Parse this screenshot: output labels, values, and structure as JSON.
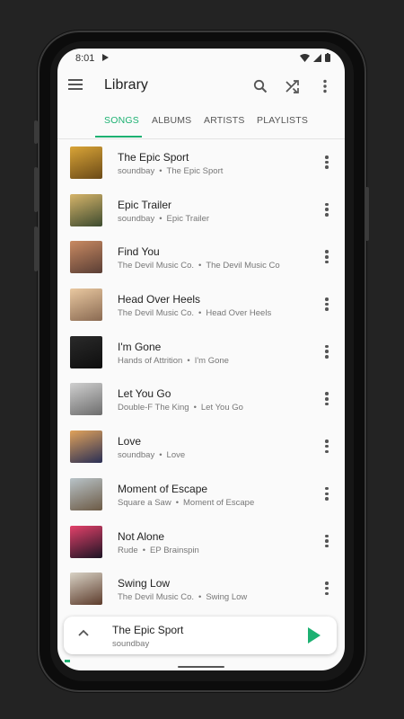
{
  "status_bar": {
    "time": "8:01"
  },
  "app_bar": {
    "title": "Library"
  },
  "tabs": [
    {
      "label": "SONGS",
      "active": true
    },
    {
      "label": "ALBUMS",
      "active": false
    },
    {
      "label": "ARTISTS",
      "active": false
    },
    {
      "label": "PLAYLISTS",
      "active": false
    }
  ],
  "songs": [
    {
      "title": "The Epic Sport",
      "artist": "soundbay",
      "album": "The Epic Sport",
      "cover_colors": [
        "#d9a437",
        "#6b4a17"
      ]
    },
    {
      "title": "Epic Trailer",
      "artist": "soundbay",
      "album": "Epic Trailer",
      "cover_colors": [
        "#d6b46a",
        "#3d4b2f"
      ]
    },
    {
      "title": "Find You",
      "artist": "The Devil Music Co.",
      "album": "The Devil Music Co",
      "cover_colors": [
        "#c98a62",
        "#5a3e35"
      ]
    },
    {
      "title": "Head Over Heels",
      "artist": "The Devil Music Co.",
      "album": "Head Over Heels",
      "cover_colors": [
        "#e9c8a0",
        "#8a6a52"
      ]
    },
    {
      "title": "I'm Gone",
      "artist": "Hands of Attrition",
      "album": "I'm Gone",
      "cover_colors": [
        "#2a2a2a",
        "#0e0e0e"
      ]
    },
    {
      "title": "Let You Go",
      "artist": "Double-F The King",
      "album": "Let You Go",
      "cover_colors": [
        "#cfcfcf",
        "#6d6d6d"
      ]
    },
    {
      "title": "Love",
      "artist": "soundbay",
      "album": "Love",
      "cover_colors": [
        "#e0a25b",
        "#2a2f55"
      ]
    },
    {
      "title": "Moment of Escape",
      "artist": "Square a Saw",
      "album": "Moment of Escape",
      "cover_colors": [
        "#b8c3c8",
        "#6c5a45"
      ]
    },
    {
      "title": "Not Alone",
      "artist": "Rude",
      "album": "EP Brainspin",
      "cover_colors": [
        "#e3416a",
        "#1c1424"
      ]
    },
    {
      "title": "Swing Low",
      "artist": "The Devil Music Co.",
      "album": "Swing Low",
      "cover_colors": [
        "#d8d2c5",
        "#5d3c2c"
      ]
    }
  ],
  "mini_player": {
    "title": "The Epic Sport",
    "artist": "soundbay"
  },
  "colors": {
    "accent": "#1db172"
  }
}
